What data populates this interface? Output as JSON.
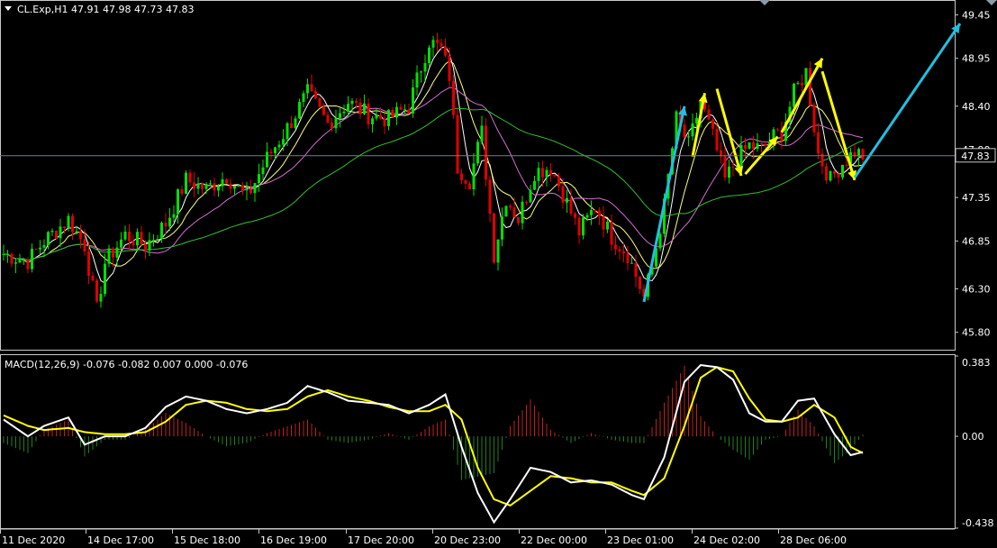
{
  "header": {
    "symbol_line": "CL.Exp,H1  47.91 47.98 47.73 47.83"
  },
  "macd_header": {
    "label": "MACD(12,26,9) -0.076 -0.082 0.007 0.000 -0.076"
  },
  "colors": {
    "background": "#000000",
    "bull": "#00e000",
    "bear": "#e00000",
    "ma_fast": "#ffffff",
    "ma_mid": "#ffff80",
    "ma_slow": "#d070d0",
    "ma_long": "#30c030",
    "arrow_yellow": "#ffff00",
    "arrow_cyan": "#20c0e0",
    "macd_line": "#ffffff",
    "signal_line": "#ffff00",
    "hist_pos": "#c02020",
    "hist_neg": "#208020",
    "current_price_line": "#708090",
    "grid": "#c8c8c8"
  },
  "chart_data": [
    {
      "type": "candlestick",
      "title": "CL.Exp,H1",
      "ylim": [
        45.6,
        49.6
      ],
      "y_ticks": [
        "49.45",
        "48.95",
        "48.40",
        "47.90",
        "47.35",
        "46.85",
        "46.30",
        "45.80"
      ],
      "current_price": "47.83",
      "x_ticks": [
        "11 Dec 2020",
        "14 Dec 17:00",
        "15 Dec 18:00",
        "16 Dec 19:00",
        "17 Dec 20:00",
        "20 Dec 23:00",
        "22 Dec 00:00",
        "23 Dec 01:00",
        "24 Dec 02:00",
        "28 Dec 06:00"
      ],
      "close_path": [
        [
          0,
          46.7
        ],
        [
          6,
          46.62
        ],
        [
          10,
          46.85
        ],
        [
          16,
          47.1
        ],
        [
          20,
          46.8
        ],
        [
          23,
          46.05
        ],
        [
          25,
          46.6
        ],
        [
          30,
          46.92
        ],
        [
          35,
          46.8
        ],
        [
          40,
          47.05
        ],
        [
          45,
          47.55
        ],
        [
          50,
          47.45
        ],
        [
          55,
          47.6
        ],
        [
          60,
          47.35
        ],
        [
          65,
          47.8
        ],
        [
          70,
          48.15
        ],
        [
          75,
          48.55
        ],
        [
          80,
          48.2
        ],
        [
          85,
          48.45
        ],
        [
          90,
          48.3
        ],
        [
          95,
          48.25
        ],
        [
          100,
          48.4
        ],
        [
          105,
          49.15
        ],
        [
          108,
          49.05
        ],
        [
          110,
          48.75
        ],
        [
          112,
          47.7
        ],
        [
          115,
          47.55
        ],
        [
          118,
          48.1
        ],
        [
          121,
          46.7
        ],
        [
          124,
          47.35
        ],
        [
          127,
          47.1
        ],
        [
          131,
          47.65
        ],
        [
          135,
          47.7
        ],
        [
          138,
          47.4
        ],
        [
          142,
          46.95
        ],
        [
          146,
          47.25
        ],
        [
          150,
          46.9
        ],
        [
          154,
          46.7
        ],
        [
          158,
          46.2
        ],
        [
          160,
          46.55
        ],
        [
          163,
          47.25
        ],
        [
          166,
          48.25
        ],
        [
          169,
          47.95
        ],
        [
          172,
          48.45
        ],
        [
          175,
          48.05
        ],
        [
          178,
          47.55
        ],
        [
          181,
          47.8
        ],
        [
          184,
          47.95
        ],
        [
          187,
          47.9
        ],
        [
          190,
          48.05
        ],
        [
          192,
          48.1
        ],
        [
          195,
          48.55
        ],
        [
          198,
          48.8
        ],
        [
          201,
          47.85
        ],
        [
          204,
          47.55
        ],
        [
          207,
          47.75
        ],
        [
          210,
          47.88
        ],
        [
          212,
          47.83
        ]
      ],
      "arrows": {
        "yellow": [
          [
            [
              170,
              47.82
            ],
            [
              173,
              48.55
            ]
          ],
          [
            [
              176,
              48.6
            ],
            [
              182,
              47.6
            ]
          ],
          [
            [
              183,
              47.62
            ],
            [
              191,
              48.05
            ]
          ],
          [
            [
              192,
              48.1
            ],
            [
              202,
              48.95
            ]
          ],
          [
            [
              202,
              48.8
            ],
            [
              210,
              47.55
            ]
          ]
        ],
        "cyan": [
          [
            [
              158,
              46.15
            ],
            [
              168,
              48.4
            ]
          ],
          [
            [
              210,
              47.58
            ],
            [
              236,
              49.35
            ]
          ]
        ]
      }
    },
    {
      "type": "macd",
      "title": "MACD(12,26,9)",
      "ylim": [
        -0.438,
        0.383
      ],
      "y_ticks": [
        "0.383",
        "0.00",
        "-0.438"
      ],
      "macd_path": [
        [
          0,
          0.08
        ],
        [
          6,
          0.0
        ],
        [
          10,
          0.05
        ],
        [
          16,
          0.09
        ],
        [
          20,
          -0.04
        ],
        [
          25,
          0.0
        ],
        [
          30,
          0.0
        ],
        [
          35,
          0.04
        ],
        [
          40,
          0.14
        ],
        [
          45,
          0.19
        ],
        [
          50,
          0.17
        ],
        [
          55,
          0.13
        ],
        [
          60,
          0.11
        ],
        [
          65,
          0.13
        ],
        [
          70,
          0.16
        ],
        [
          75,
          0.24
        ],
        [
          80,
          0.21
        ],
        [
          85,
          0.17
        ],
        [
          90,
          0.16
        ],
        [
          95,
          0.15
        ],
        [
          100,
          0.11
        ],
        [
          105,
          0.15
        ],
        [
          109,
          0.2
        ],
        [
          113,
          -0.05
        ],
        [
          117,
          -0.27
        ],
        [
          121,
          -0.41
        ],
        [
          125,
          -0.3
        ],
        [
          130,
          -0.15
        ],
        [
          135,
          -0.17
        ],
        [
          140,
          -0.22
        ],
        [
          145,
          -0.21
        ],
        [
          150,
          -0.23
        ],
        [
          155,
          -0.28
        ],
        [
          158,
          -0.3
        ],
        [
          163,
          -0.1
        ],
        [
          168,
          0.26
        ],
        [
          172,
          0.34
        ],
        [
          176,
          0.33
        ],
        [
          180,
          0.27
        ],
        [
          184,
          0.11
        ],
        [
          188,
          0.07
        ],
        [
          192,
          0.07
        ],
        [
          196,
          0.17
        ],
        [
          200,
          0.18
        ],
        [
          205,
          0.01
        ],
        [
          209,
          -0.09
        ],
        [
          212,
          -0.075
        ]
      ],
      "signal_path": [
        [
          0,
          0.1
        ],
        [
          6,
          0.05
        ],
        [
          10,
          0.03
        ],
        [
          16,
          0.04
        ],
        [
          20,
          0.02
        ],
        [
          25,
          0.01
        ],
        [
          30,
          0.01
        ],
        [
          35,
          0.02
        ],
        [
          40,
          0.07
        ],
        [
          45,
          0.15
        ],
        [
          50,
          0.17
        ],
        [
          55,
          0.16
        ],
        [
          60,
          0.13
        ],
        [
          65,
          0.12
        ],
        [
          70,
          0.13
        ],
        [
          75,
          0.19
        ],
        [
          80,
          0.22
        ],
        [
          85,
          0.19
        ],
        [
          90,
          0.17
        ],
        [
          95,
          0.14
        ],
        [
          100,
          0.12
        ],
        [
          105,
          0.12
        ],
        [
          109,
          0.15
        ],
        [
          113,
          0.08
        ],
        [
          117,
          -0.15
        ],
        [
          121,
          -0.3
        ],
        [
          125,
          -0.33
        ],
        [
          130,
          -0.26
        ],
        [
          135,
          -0.19
        ],
        [
          140,
          -0.2
        ],
        [
          145,
          -0.22
        ],
        [
          150,
          -0.22
        ],
        [
          155,
          -0.26
        ],
        [
          158,
          -0.28
        ],
        [
          163,
          -0.2
        ],
        [
          168,
          0.05
        ],
        [
          172,
          0.28
        ],
        [
          176,
          0.33
        ],
        [
          180,
          0.31
        ],
        [
          184,
          0.18
        ],
        [
          188,
          0.08
        ],
        [
          192,
          0.07
        ],
        [
          196,
          0.09
        ],
        [
          200,
          0.15
        ],
        [
          205,
          0.09
        ],
        [
          209,
          -0.05
        ],
        [
          212,
          -0.08
        ]
      ]
    }
  ]
}
